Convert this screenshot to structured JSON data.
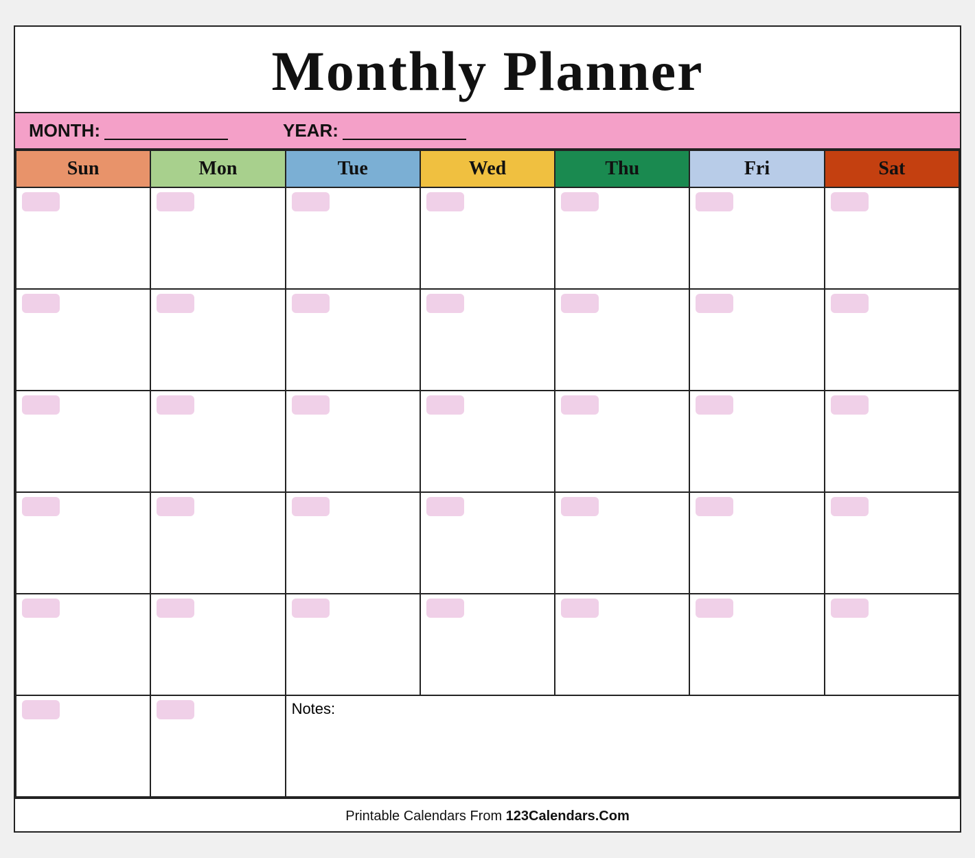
{
  "title": "Monthly Planner",
  "month_bar": {
    "month_label": "MONTH:",
    "year_label": "YEAR:"
  },
  "days": {
    "sun": "Sun",
    "mon": "Mon",
    "tue": "Tue",
    "wed": "Wed",
    "thu": "Thu",
    "fri": "Fri",
    "sat": "Sat"
  },
  "notes_label": "Notes:",
  "footer": {
    "text": "Printable Calendars From ",
    "brand": "123Calendars.Com"
  },
  "colors": {
    "sun_bg": "#e8936a",
    "mon_bg": "#a8d08d",
    "tue_bg": "#7bafd4",
    "wed_bg": "#f0c040",
    "thu_bg": "#1a8a50",
    "fri_bg": "#b8cce8",
    "sat_bg": "#c44010",
    "header_bar": "#f4a0c8",
    "day_number_bg": "#f0d0e8"
  }
}
